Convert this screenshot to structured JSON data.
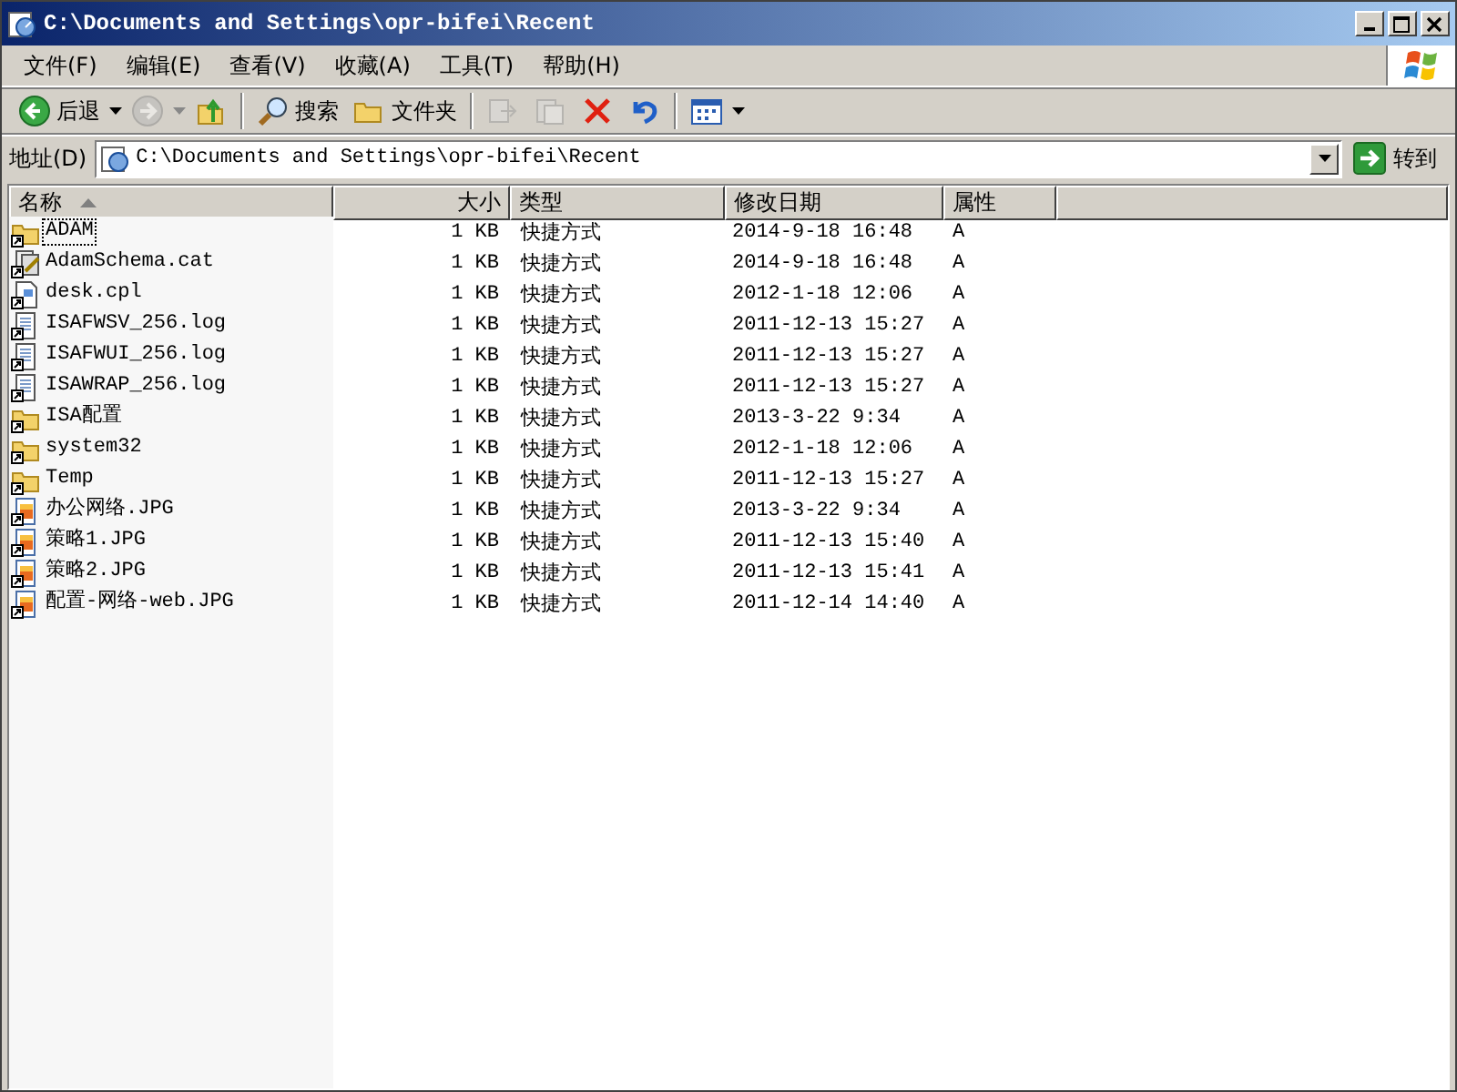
{
  "window": {
    "title": "C:\\Documents and Settings\\opr-bifei\\Recent"
  },
  "menu": [
    "文件(F)",
    "编辑(E)",
    "查看(V)",
    "收藏(A)",
    "工具(T)",
    "帮助(H)"
  ],
  "toolbar": [
    {
      "kind": "back",
      "label": "后退",
      "disabled": false
    },
    {
      "kind": "forward",
      "disabled": true
    },
    {
      "kind": "up",
      "disabled": false
    },
    {
      "kind": "search",
      "label": "搜索",
      "disabled": false
    },
    {
      "kind": "folders",
      "label": "文件夹",
      "disabled": false
    },
    {
      "kind": "move",
      "disabled": true
    },
    {
      "kind": "copy",
      "disabled": true
    },
    {
      "kind": "delete",
      "disabled": false
    },
    {
      "kind": "undo",
      "disabled": false
    },
    {
      "kind": "views",
      "disabled": false
    }
  ],
  "address": {
    "label": "地址(D)",
    "value": "C:\\Documents and Settings\\opr-bifei\\Recent",
    "go": "转到"
  },
  "table": {
    "columns": [
      {
        "label": "名称",
        "sorted": true
      },
      {
        "label": "大小",
        "sorted": false
      },
      {
        "label": "类型",
        "sorted": false
      },
      {
        "label": "修改日期",
        "sorted": false
      },
      {
        "label": "属性",
        "sorted": false
      }
    ],
    "rows": [
      {
        "kind": "folder",
        "name": "ADAM",
        "size": "1 KB",
        "type": "快捷方式",
        "modified": "2014-9-18 16:48",
        "attr": "A",
        "focused": true
      },
      {
        "kind": "catalog",
        "name": "AdamSchema.cat",
        "size": "1 KB",
        "type": "快捷方式",
        "modified": "2014-9-18 16:48",
        "attr": "A",
        "focused": false
      },
      {
        "kind": "applet",
        "name": "desk.cpl",
        "size": "1 KB",
        "type": "快捷方式",
        "modified": "2012-1-18 12:06",
        "attr": "A",
        "focused": false
      },
      {
        "kind": "text",
        "name": "ISAFWSV_256.log",
        "size": "1 KB",
        "type": "快捷方式",
        "modified": "2011-12-13 15:27",
        "attr": "A",
        "focused": false
      },
      {
        "kind": "text",
        "name": "ISAFWUI_256.log",
        "size": "1 KB",
        "type": "快捷方式",
        "modified": "2011-12-13 15:27",
        "attr": "A",
        "focused": false
      },
      {
        "kind": "text",
        "name": "ISAWRAP_256.log",
        "size": "1 KB",
        "type": "快捷方式",
        "modified": "2011-12-13 15:27",
        "attr": "A",
        "focused": false
      },
      {
        "kind": "folder",
        "name": "ISA配置",
        "size": "1 KB",
        "type": "快捷方式",
        "modified": "2013-3-22 9:34",
        "attr": "A",
        "focused": false
      },
      {
        "kind": "folder",
        "name": "system32",
        "size": "1 KB",
        "type": "快捷方式",
        "modified": "2012-1-18 12:06",
        "attr": "A",
        "focused": false
      },
      {
        "kind": "folder",
        "name": "Temp",
        "size": "1 KB",
        "type": "快捷方式",
        "modified": "2011-12-13 15:27",
        "attr": "A",
        "focused": false
      },
      {
        "kind": "image",
        "name": "办公网络.JPG",
        "size": "1 KB",
        "type": "快捷方式",
        "modified": "2013-3-22 9:34",
        "attr": "A",
        "focused": false
      },
      {
        "kind": "image",
        "name": "策略1.JPG",
        "size": "1 KB",
        "type": "快捷方式",
        "modified": "2011-12-13 15:40",
        "attr": "A",
        "focused": false
      },
      {
        "kind": "image",
        "name": "策略2.JPG",
        "size": "1 KB",
        "type": "快捷方式",
        "modified": "2011-12-13 15:41",
        "attr": "A",
        "focused": false
      },
      {
        "kind": "image",
        "name": "配置-网络-web.JPG",
        "size": "1 KB",
        "type": "快捷方式",
        "modified": "2011-12-14 14:40",
        "attr": "A",
        "focused": false
      }
    ]
  }
}
